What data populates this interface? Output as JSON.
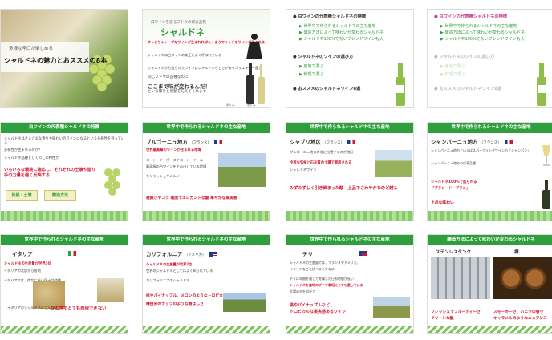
{
  "slides": [
    {
      "id": 1,
      "kicker": "多様な辛口が楽しめる",
      "title": "シャルドネの魅力とおススメの8本"
    },
    {
      "id": 2,
      "kicker": "白ワインを造るブドウの代表品種",
      "title": "シャルドネ",
      "line1": "すっきりシャープなワインが生まれればこくまろでリッチなワインが生まれる",
      "line2": "シャルドネは白ワインの女王とよく呼ばれている",
      "line3": "シャルドネから造られたワインはシャルドネらしさがありバラエティー豊か",
      "line4": "同じブドウの品種なのに",
      "highlight": "ここまで味が変わるんだ！",
      "line5": "という驚きと感動を与えてくれます",
      "labels": [
        "シャルドネ",
        "ボトル",
        "ボトル"
      ]
    },
    {
      "id": 3,
      "items": [
        "白ワインの代表種シャルドネの特徴",
        "世界中で作られるシャルドネの主な産地",
        "醸造方法によって味わいが変わるシャルドネ",
        "シャルドネ100%でないブレンドワインも大",
        "シャルドネのワインの選び方",
        "産地で選ぶ",
        "料理で選ぶ",
        "おススメのシャルドネワイン8選"
      ]
    },
    {
      "id": 4,
      "items": [
        "白ワインの代表種シャルドネの特徴",
        "世界中で作られるシャルドネの主な産地",
        "醸造方法によって味わいが変わるシャルドネ",
        "シャルドネ100%でないブレンドワインも大",
        "シャルドネのワインの選び方",
        "産地で選ぶ",
        "料理で選ぶ",
        "おススメのシャルドネワイン8選"
      ]
    },
    {
      "id": 5,
      "header": "白ワインの代表種シャルドネの特徴",
      "line1": "シャルドネはさまざまな香りや味わいのワインになるという多様性を持っている",
      "line2": "多様性が生まれるのか？",
      "line3": "シャルドネ品種としてのこの特性が",
      "highlight": "いろいろな環境に適応し、それぞれの土壌や造り手の力量を強く反映する",
      "btn1": "気候・土壌",
      "btn2": "醸造方法"
    },
    {
      "id": 6,
      "header": "世界中で作られるシャルドネの主な産地",
      "region": "ブルゴーニュ地方",
      "country": "フランス",
      "line1": "世界最高峰のワインが生まれる地域",
      "line2": "コート・ド・ボーヌやコート・ドール",
      "line3": "最高級の白ワインを生み出している地域",
      "line4": "モンラッシェやムルソー",
      "highlight1": "複雑さやコク",
      "highlight2": "確固でエレガントな酸",
      "highlight3": "華やかな果実感"
    },
    {
      "id": 7,
      "header": "世界中で作られるシャルドネの主な産地",
      "region": "シャブリ地区",
      "country": "フランス",
      "line1": "ブルゴーニュ地方の北に位置するのが地区",
      "line2": "冷涼な気候と石灰質の土壌で栽培される",
      "line3": "シャルドネワイン",
      "highlight": "みずみずしく引き締まった酸　上品でさわやかなのど越し"
    },
    {
      "id": 8,
      "header": "世界中で作られるシャルドネの主な産地",
      "region": "シャンパーニュ地方",
      "country": "フランス",
      "line1": "シャンパーニュ地方といえばスパークリングワインの「シャンパン」",
      "line2": "シャンパーニュ地方の代表品種",
      "highlight_a": "シャルドネ100%で造られる",
      "highlight_b": "「ブラン・ド・ブラン」",
      "line3": "上品な味わい"
    },
    {
      "id": 9,
      "header": "世界中で作られるシャルドネの主な産地",
      "region": "イタリア",
      "line1": "シャルドネの生産量が世界3位",
      "line2": "イタリアの北部から各地",
      "line3": "イタリアでは、南北に長い国土が特徴",
      "highlight": "ひと言でとても表現できない",
      "line4": "「イタリアのシャルドネはこんな味」"
    },
    {
      "id": 10,
      "header": "世界中で作られるシャルドネの主な産地",
      "region": "カリフォルニア",
      "country": "アメリカ",
      "line1": "シャルドネの生産量が世界2位",
      "line2": "世界のシャルドネとしてはよく知られている",
      "line3": "カリフォルニアのシャルドネ",
      "highlight1": "桃やパイナップル、メロンのようなトロピカルな果実感",
      "highlight2": "樽由来のナッツのような香ばしさ"
    },
    {
      "id": 11,
      "header": "世界中で作られるシャルドネの主な産地",
      "region": "チリ",
      "line1": "シャルドネの生産量では、フランスやアメリカ、",
      "line2": "イタリアなどと比べると少なめ",
      "line3": "チリは年間を通して乾燥した日照時間が長い",
      "line4": "太陽の光を浴びて",
      "highlight1": "シャルドネを産地のブドウ栽培にとても適している",
      "highlight2": "桃やパイナップルなど",
      "highlight3": "トロピカルな果実感あるワイン"
    },
    {
      "id": 12,
      "header": "醸造方法によって味わいが変わるシャルドネ",
      "left_label": "ステンレスタンク",
      "right_label": "樽",
      "left_a": "フレッシュでフルーティーさ",
      "left_b": "クリーンな酸",
      "right_a": "スモーキーさ、バニラの香り",
      "right_b": "キャラメルのようなニュアンス"
    }
  ],
  "colors": {
    "primary_green": "#2f9e3c",
    "accent_red": "#d0172f",
    "accent_pink": "#c43d8c",
    "leaf_green": "#6fc24f"
  },
  "icons": [
    "grape-icon",
    "wine-bottle-icon",
    "wine-glass-icon",
    "france-flag-icon",
    "italy-flag-icon",
    "usa-flag-icon",
    "chile-flag-icon"
  ]
}
